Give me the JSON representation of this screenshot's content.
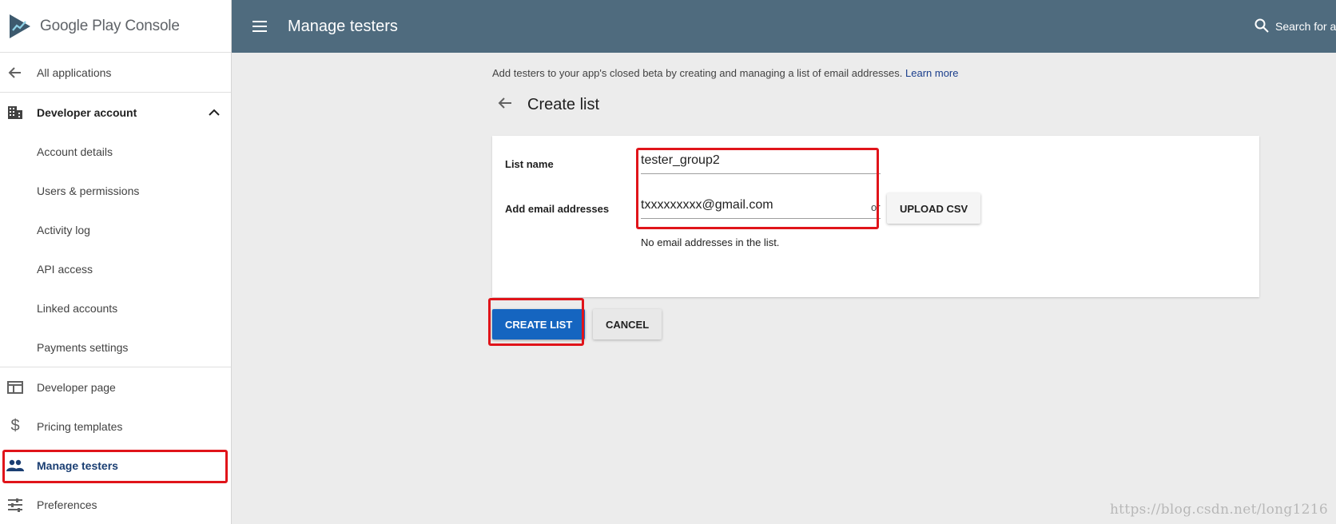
{
  "brand": {
    "name": "Google Play Console"
  },
  "sidebar": {
    "items": [
      {
        "label": "All applications",
        "icon": "arrow-left-icon"
      },
      {
        "label": "Developer account",
        "icon": "building-icon"
      },
      {
        "label": "Account details"
      },
      {
        "label": "Users & permissions"
      },
      {
        "label": "Activity log"
      },
      {
        "label": "API access"
      },
      {
        "label": "Linked accounts"
      },
      {
        "label": "Payments settings"
      },
      {
        "label": "Developer page",
        "icon": "web-page-icon"
      },
      {
        "label": "Pricing templates",
        "icon": "dollar-icon"
      },
      {
        "label": "Manage testers",
        "icon": "people-icon"
      },
      {
        "label": "Preferences",
        "icon": "sliders-icon"
      }
    ],
    "active": "Manage testers"
  },
  "topbar": {
    "title": "Manage testers",
    "search_label": "Search for a"
  },
  "main": {
    "intro_text": "Add testers to your app's closed beta by creating and managing a list of email addresses.",
    "learn_more": "Learn more",
    "page_title": "Create list",
    "list_name_label": "List name",
    "list_name_value": "tester_group2",
    "email_label": "Add email addresses",
    "email_value": "txxxxxxxxx@gmail.com",
    "or_text": "or",
    "upload_csv": "UPLOAD CSV",
    "empty_hint": "No email addresses in the list.",
    "create_button": "CREATE LIST",
    "cancel_button": "CANCEL"
  },
  "watermark": "https://blog.csdn.net/long1216",
  "colors": {
    "topbar": "#4f6b7e",
    "primary_button": "#1565c0",
    "highlight": "#e0141a",
    "active_nav": "#1a3e72"
  }
}
